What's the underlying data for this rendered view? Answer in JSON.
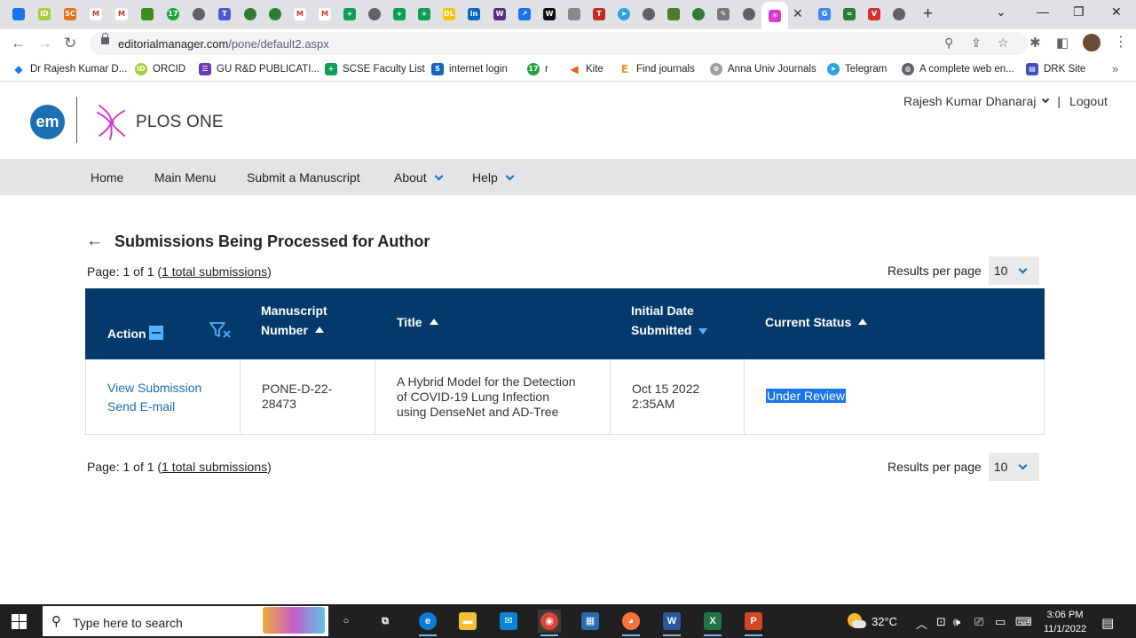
{
  "browser": {
    "tabs": [
      {
        "icon": "bookmark-tab-icon",
        "color": "#1a73e8",
        "glyph": ""
      },
      {
        "icon": "orcid-icon",
        "color": "#a6ce39",
        "glyph": "iD"
      },
      {
        "icon": "sc-icon",
        "color": "#e9711c",
        "glyph": "SC"
      },
      {
        "icon": "gmail-icon",
        "color": "#ffffff",
        "glyph": "M"
      },
      {
        "icon": "gmail-icon",
        "color": "#ffffff",
        "glyph": "M"
      },
      {
        "icon": "doc-icon",
        "color": "#3c8c1e",
        "glyph": ""
      },
      {
        "icon": "site-icon",
        "color": "#1fa33a",
        "glyph": "17"
      },
      {
        "icon": "globe-icon",
        "color": "#5f6368",
        "glyph": ""
      },
      {
        "icon": "teams-icon",
        "color": "#5059c9",
        "glyph": "T"
      },
      {
        "icon": "eye-icon",
        "color": "#2e7d32",
        "glyph": ""
      },
      {
        "icon": "eye-icon",
        "color": "#2e7d32",
        "glyph": ""
      },
      {
        "icon": "gmail-icon",
        "color": "#ffffff",
        "glyph": "M"
      },
      {
        "icon": "gmail-icon",
        "color": "#ffffff",
        "glyph": "M"
      },
      {
        "icon": "plus-doc-icon",
        "color": "#0f9d58",
        "glyph": "+"
      },
      {
        "icon": "globe-icon",
        "color": "#5f6368",
        "glyph": ""
      },
      {
        "icon": "plus-doc-icon",
        "color": "#0f9d58",
        "glyph": "+"
      },
      {
        "icon": "plus-doc-icon",
        "color": "#0f9d58",
        "glyph": "+"
      },
      {
        "icon": "dl-icon",
        "color": "#f7c600",
        "glyph": "DL"
      },
      {
        "icon": "linkedin-icon",
        "color": "#0a66c2",
        "glyph": "in"
      },
      {
        "icon": "wos-icon",
        "color": "#5b2c83",
        "glyph": "W"
      },
      {
        "icon": "chart-icon",
        "color": "#1a73e8",
        "glyph": "↗"
      },
      {
        "icon": "wiki-icon",
        "color": "#111111",
        "glyph": "W"
      },
      {
        "icon": "diamond-icon",
        "color": "#8a8a8a",
        "glyph": ""
      },
      {
        "icon": "t-icon",
        "color": "#c62828",
        "glyph": "T"
      },
      {
        "icon": "telegram-icon",
        "color": "#2aa3de",
        "glyph": "➤"
      },
      {
        "icon": "globe-icon",
        "color": "#5f6368",
        "glyph": ""
      },
      {
        "icon": "leaf-icon",
        "color": "#4a7c2a",
        "glyph": ""
      },
      {
        "icon": "eye-icon",
        "color": "#2e7d32",
        "glyph": ""
      },
      {
        "icon": "edit-icon",
        "color": "#7a7a7a",
        "glyph": "✎"
      },
      {
        "icon": "globe-icon",
        "color": "#5f6368",
        "glyph": ""
      },
      {
        "icon": "plos-tab-icon",
        "color": "#d63ad0",
        "glyph": "✳"
      },
      {
        "icon": "google-icon",
        "color": "#4285f4",
        "glyph": "G"
      },
      {
        "icon": "green-tab-icon",
        "color": "#2e7d32",
        "glyph": "≈"
      },
      {
        "icon": "vivaldi-icon",
        "color": "#d32f2f",
        "glyph": "V"
      },
      {
        "icon": "globe-icon",
        "color": "#5f6368",
        "glyph": ""
      }
    ],
    "url_host": "editorialmanager.com",
    "url_path": "/pone/default2.aspx",
    "bookmarks": [
      {
        "label": "Dr Rajesh Kumar D...",
        "icon": "bookmark-icon",
        "color": "#1a73e8",
        "glyph": "◆"
      },
      {
        "label": "ORCID",
        "icon": "orcid-icon",
        "color": "#a6ce39",
        "glyph": "iD"
      },
      {
        "label": "GU R&D PUBLICATI...",
        "icon": "form-icon",
        "color": "#673ab7",
        "glyph": "☰"
      },
      {
        "label": "SCSE Faculty List",
        "icon": "sheet-icon",
        "color": "#0f9d58",
        "glyph": "+"
      },
      {
        "label": "internet login",
        "icon": "s-icon",
        "color": "#1565c0",
        "glyph": "S"
      },
      {
        "label": "r",
        "icon": "green-circle-icon",
        "color": "#1fa33a",
        "glyph": "17"
      },
      {
        "label": "Kite",
        "icon": "kite-icon",
        "color": "#f05a22",
        "glyph": "◀"
      },
      {
        "label": "Find journals",
        "icon": "e-icon",
        "color": "#f29111",
        "glyph": "E"
      },
      {
        "label": "Anna Univ Journals",
        "icon": "seal-icon",
        "color": "#9e9e9e",
        "glyph": "⊛"
      },
      {
        "label": "Telegram",
        "icon": "telegram-icon",
        "color": "#2aa3de",
        "glyph": "➤"
      },
      {
        "label": "A complete web en...",
        "icon": "globe-icon",
        "color": "#5f6368",
        "glyph": "◍"
      },
      {
        "label": "DRK Site",
        "icon": "site-icon",
        "color": "#3f51b5",
        "glyph": "▤"
      }
    ]
  },
  "site": {
    "logo_text": "em",
    "journal_name": "PLOS ONE",
    "user_name": "Rajesh Kumar Dhanaraj",
    "separator": "|",
    "logout_label": "Logout",
    "nav": [
      {
        "label": "Home"
      },
      {
        "label": "Main Menu"
      },
      {
        "label": "Submit a Manuscript"
      },
      {
        "label": "About"
      },
      {
        "label": "Help"
      }
    ]
  },
  "content": {
    "page_title": "Submissions Being Processed for Author",
    "pager_prefix": "Page: 1 of 1 (",
    "pager_link": "1 total submissions",
    "pager_suffix": ")",
    "results_per_page_label": "Results per page",
    "results_per_page_value": "10",
    "columns": {
      "action": "Action",
      "manuscript_line1": "Manuscript",
      "manuscript_line2": "Number",
      "title": "Title",
      "date_line1": "Initial Date",
      "date_line2": "Submitted",
      "status": "Current Status"
    },
    "row": {
      "view_submission": "View Submission",
      "send_email": "Send E-mail",
      "manuscript_number_line1": "PONE-D-22-",
      "manuscript_number_line2": "28473",
      "title_line1": "A Hybrid Model for the Detection",
      "title_line2": "of COVID-19 Lung Infection",
      "title_line3": "using DenseNet and AD-Tree",
      "date_line1": "Oct 15 2022",
      "date_line2": "2:35AM",
      "status": "Under Review"
    }
  },
  "taskbar": {
    "search_placeholder": "Type here to search",
    "temperature": "32°C",
    "time": "3:06 PM",
    "date": "11/1/2022",
    "apps": [
      {
        "icon": "cortana-icon",
        "glyph": "○",
        "color": "transparent"
      },
      {
        "icon": "task-view-icon",
        "glyph": "⧉",
        "color": "transparent"
      },
      {
        "icon": "edge-icon",
        "glyph": "e",
        "color": "#0c7bd6"
      },
      {
        "icon": "file-explorer-icon",
        "glyph": "▬",
        "color": "#f2c037"
      },
      {
        "icon": "mail-icon",
        "glyph": "✉",
        "color": "#0a84d6"
      },
      {
        "icon": "chrome-icon",
        "glyph": "◉",
        "color": "#db4437"
      },
      {
        "icon": "store-icon",
        "glyph": "▦",
        "color": "#2b6cb0"
      },
      {
        "icon": "firefox-icon",
        "glyph": "◕",
        "color": "#ff7139"
      },
      {
        "icon": "word-icon",
        "glyph": "W",
        "color": "#2b579a"
      },
      {
        "icon": "excel-icon",
        "glyph": "X",
        "color": "#217346"
      },
      {
        "icon": "powerpoint-icon",
        "glyph": "P",
        "color": "#d24726"
      }
    ]
  },
  "colors": {
    "accent": "#1c6fb0",
    "table_header": "#043a6b",
    "highlight": "#1a73e8"
  }
}
